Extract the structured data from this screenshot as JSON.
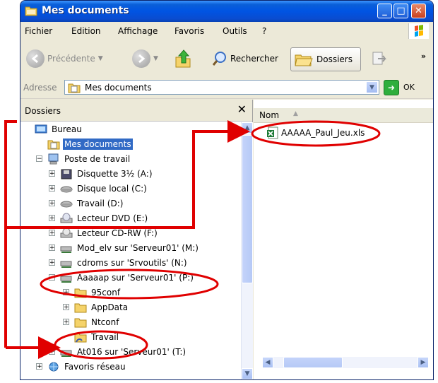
{
  "window": {
    "title": "Mes documents",
    "controls": {
      "minimize": "_",
      "maximize": "□",
      "close": "✕"
    }
  },
  "menu": [
    "Fichier",
    "Edition",
    "Affichage",
    "Favoris",
    "Outils",
    "?"
  ],
  "toolbar": {
    "back": "Précédente",
    "search": "Rechercher",
    "folders": "Dossiers",
    "more": "»"
  },
  "address": {
    "label": "Adresse",
    "value": "Mes documents",
    "go": "OK"
  },
  "folders_pane": {
    "title": "Dossiers",
    "close": "✕",
    "tree": [
      {
        "label": "Bureau",
        "icon": "desktop-icon",
        "level": 0,
        "expander": ""
      },
      {
        "label": "Mes documents",
        "icon": "my-documents-icon",
        "level": 1,
        "expander": "",
        "selected": true
      },
      {
        "label": "Poste de travail",
        "icon": "computer-icon",
        "level": 1,
        "expander": "−"
      },
      {
        "label": "Disquette 3½ (A:)",
        "icon": "floppy-icon",
        "level": 2,
        "expander": "+"
      },
      {
        "label": "Disque local (C:)",
        "icon": "hard-disk-icon",
        "level": 2,
        "expander": "+"
      },
      {
        "label": "Travail (D:)",
        "icon": "hard-disk-icon",
        "level": 2,
        "expander": "+"
      },
      {
        "label": "Lecteur DVD (E:)",
        "icon": "dvd-drive-icon",
        "level": 2,
        "expander": "+"
      },
      {
        "label": "Lecteur CD-RW (F:)",
        "icon": "cd-drive-icon",
        "level": 2,
        "expander": "+"
      },
      {
        "label": "Mod_elv sur 'Serveur01' (M:)",
        "icon": "network-drive-icon",
        "level": 2,
        "expander": "+"
      },
      {
        "label": "cdroms sur 'Srvoutils' (N:)",
        "icon": "network-drive-icon",
        "level": 2,
        "expander": "+"
      },
      {
        "label": "Aaaaap sur 'Serveur01' (P:)",
        "icon": "network-drive-icon",
        "level": 2,
        "expander": "−"
      },
      {
        "label": "95conf",
        "icon": "folder-icon",
        "level": 3,
        "expander": "+"
      },
      {
        "label": "AppData",
        "icon": "folder-icon",
        "level": 3,
        "expander": "+"
      },
      {
        "label": "Ntconf",
        "icon": "folder-icon",
        "level": 3,
        "expander": "+"
      },
      {
        "label": "Travail",
        "icon": "shared-folder-icon",
        "level": 3,
        "expander": ""
      },
      {
        "label": "At016 sur 'Serveur01' (T:)",
        "icon": "network-drive-icon",
        "level": 2,
        "expander": "+"
      },
      {
        "label": "Favoris réseau",
        "icon": "network-places-icon",
        "level": 1,
        "expander": "+"
      }
    ]
  },
  "files_pane": {
    "column": "Nom",
    "files": [
      {
        "name": "AAAAA_Paul_Jeu.xls",
        "icon": "excel-file-icon"
      }
    ]
  },
  "annotations": {
    "color": "#e00000"
  }
}
